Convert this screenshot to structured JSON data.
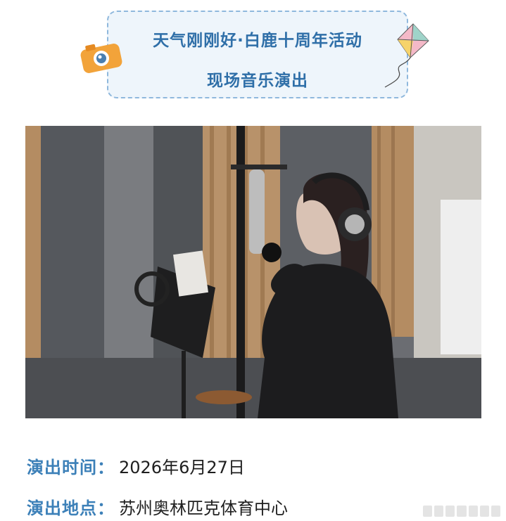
{
  "banner": {
    "title_line1": "天气刚刚好·白鹿十周年活动",
    "title_line2": "现场音乐演出",
    "left_icon": "camera-icon",
    "right_icon": "kite-icon"
  },
  "photo": {
    "subject": "singer-in-recording-studio",
    "colors": {
      "wall": "#5f6166",
      "wood": "#b48c62",
      "jacket": "#1c1c1e"
    }
  },
  "event_info": {
    "time_label": "演出时间：",
    "time_value": "2026年6月27日",
    "place_label": "演出地点：",
    "place_value": "苏州奥林匹克体育中心"
  },
  "colors": {
    "accent": "#3c80b8",
    "banner_bg": "#eef5fb",
    "banner_border": "#8fb8dd"
  }
}
